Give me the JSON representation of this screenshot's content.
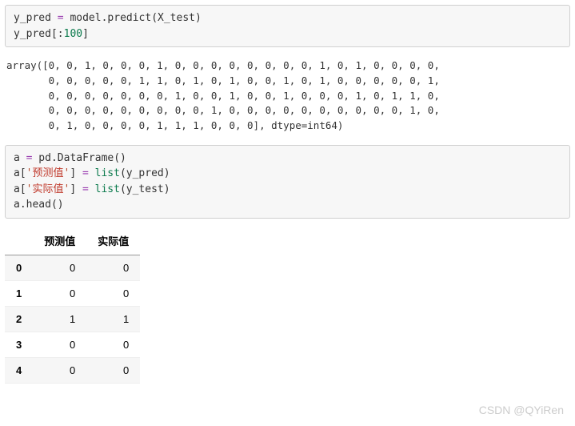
{
  "cell1": {
    "line1_a": "y_pred ",
    "line1_b": "=",
    "line1_c": " model.predict(X_test)",
    "line2_a": "y_pred[:",
    "line2_b": "100",
    "line2_c": "]"
  },
  "output1": "array([0, 0, 1, 0, 0, 0, 1, 0, 0, 0, 0, 0, 0, 0, 0, 1, 0, 1, 0, 0, 0, 0,\n       0, 0, 0, 0, 0, 1, 1, 0, 1, 0, 1, 0, 0, 1, 0, 1, 0, 0, 0, 0, 0, 1,\n       0, 0, 0, 0, 0, 0, 0, 1, 0, 0, 1, 0, 0, 1, 0, 0, 0, 1, 0, 1, 1, 0,\n       0, 0, 0, 0, 0, 0, 0, 0, 0, 1, 0, 0, 0, 0, 0, 0, 0, 0, 0, 0, 1, 0,\n       0, 1, 0, 0, 0, 0, 1, 1, 1, 0, 0, 0], dtype=int64)",
  "cell2": {
    "line1_a": "a ",
    "line1_b": "=",
    "line1_c": " pd.DataFrame()",
    "line2_a": "a[",
    "line2_b": "'",
    "line2_c": "预测值",
    "line2_d": "'",
    "line2_e": "] ",
    "line2_f": "=",
    "line2_g": " ",
    "line2_h": "list",
    "line2_i": "(y_pred)",
    "line3_a": "a[",
    "line3_b": "'",
    "line3_c": "实际值",
    "line3_d": "'",
    "line3_e": "] ",
    "line3_f": "=",
    "line3_g": " ",
    "line3_h": "list",
    "line3_i": "(y_test)",
    "line4": "a.head()"
  },
  "table": {
    "columns": [
      "预测值",
      "实际值"
    ],
    "rows": [
      {
        "idx": "0",
        "pred": "0",
        "actual": "0"
      },
      {
        "idx": "1",
        "pred": "0",
        "actual": "0"
      },
      {
        "idx": "2",
        "pred": "1",
        "actual": "1"
      },
      {
        "idx": "3",
        "pred": "0",
        "actual": "0"
      },
      {
        "idx": "4",
        "pred": "0",
        "actual": "0"
      }
    ]
  },
  "watermark": "CSDN @QYiRen"
}
